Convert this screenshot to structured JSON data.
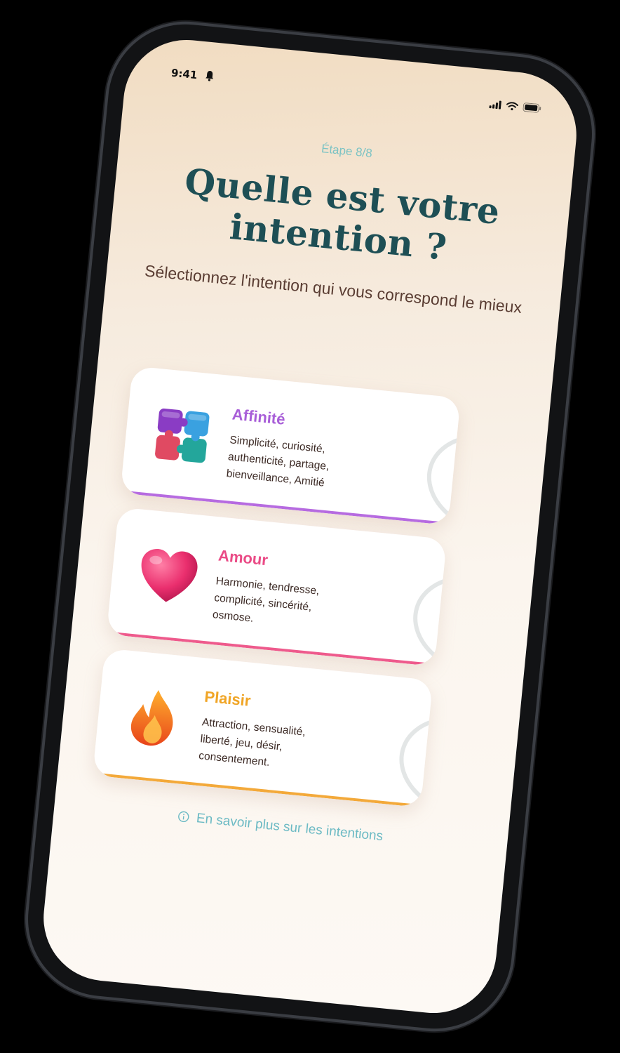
{
  "status": {
    "time": "9:41",
    "icons": [
      "bell-icon",
      "signal-icon",
      "wifi-icon",
      "battery-icon"
    ]
  },
  "step_label": "Étape 8/8",
  "title": "Quelle est votre intention ?",
  "subtitle": "Sélectionnez l'intention qui vous correspond le mieux",
  "intentions": [
    {
      "name": "Affinité",
      "description": "Simplicité, curiosité, authenticité, partage, bienveillance, Amitié",
      "icon": "puzzle-icon",
      "color": "#a85ed8"
    },
    {
      "name": "Amour",
      "description": "Harmonie, tendresse, complicité, sincérité, osmose.",
      "icon": "heart-icon",
      "color": "#ea4b86"
    },
    {
      "name": "Plaisir",
      "description": "Attraction, sensualité, liberté, jeu, désir, consentement.",
      "icon": "flame-icon",
      "color": "#f0a526"
    }
  ],
  "info_link": "En savoir plus sur les intentions"
}
